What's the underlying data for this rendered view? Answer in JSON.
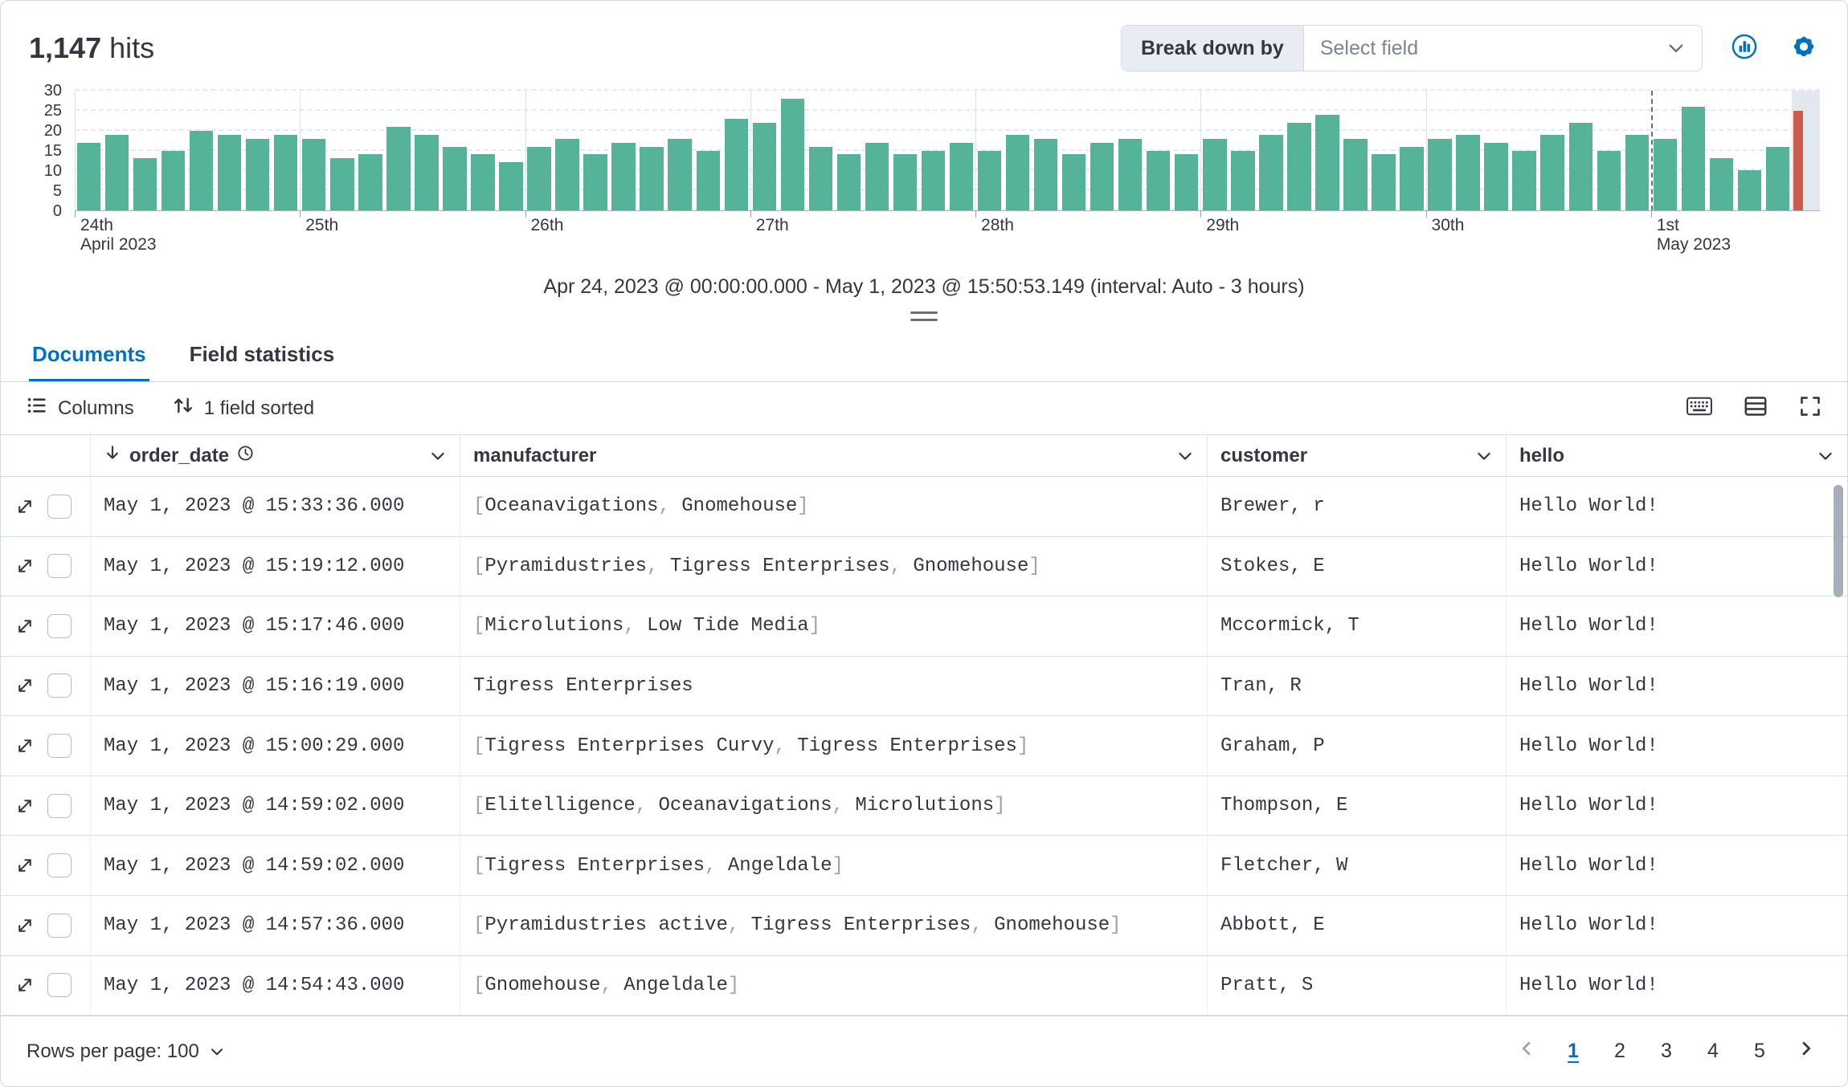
{
  "header": {
    "hits_count": "1,147",
    "hits_label": "hits",
    "breakdown_label": "Break down by",
    "breakdown_placeholder": "Select field"
  },
  "time_range": "Apr 24, 2023 @ 00:00:00.000 - May 1, 2023 @ 15:50:53.149 (interval: Auto - 3 hours)",
  "tabs": {
    "documents": "Documents",
    "field_statistics": "Field statistics"
  },
  "toolbar": {
    "columns": "Columns",
    "sorted": "1 field sorted"
  },
  "table": {
    "columns": {
      "order_date": "order_date",
      "manufacturer": "manufacturer",
      "customer": "customer",
      "hello": "hello"
    },
    "rows": [
      {
        "order_date": "May 1, 2023 @ 15:33:36.000",
        "manufacturer": [
          "Oceanavigations",
          "Gnomehouse"
        ],
        "customer": "Brewer, r",
        "hello": "Hello World!"
      },
      {
        "order_date": "May 1, 2023 @ 15:19:12.000",
        "manufacturer": [
          "Pyramidustries",
          "Tigress Enterprises",
          "Gnomehouse"
        ],
        "customer": "Stokes, E",
        "hello": "Hello World!"
      },
      {
        "order_date": "May 1, 2023 @ 15:17:46.000",
        "manufacturer": [
          "Microlutions",
          "Low Tide Media"
        ],
        "customer": "Mccormick, T",
        "hello": "Hello World!"
      },
      {
        "order_date": "May 1, 2023 @ 15:16:19.000",
        "manufacturer": "Tigress Enterprises",
        "customer": "Tran, R",
        "hello": "Hello World!"
      },
      {
        "order_date": "May 1, 2023 @ 15:00:29.000",
        "manufacturer": [
          "Tigress Enterprises Curvy",
          "Tigress Enterprises"
        ],
        "customer": "Graham, P",
        "hello": "Hello World!"
      },
      {
        "order_date": "May 1, 2023 @ 14:59:02.000",
        "manufacturer": [
          "Elitelligence",
          "Oceanavigations",
          "Microlutions"
        ],
        "customer": "Thompson, E",
        "hello": "Hello World!"
      },
      {
        "order_date": "May 1, 2023 @ 14:59:02.000",
        "manufacturer": [
          "Tigress Enterprises",
          "Angeldale"
        ],
        "customer": "Fletcher, W",
        "hello": "Hello World!"
      },
      {
        "order_date": "May 1, 2023 @ 14:57:36.000",
        "manufacturer": [
          "Pyramidustries active",
          "Tigress Enterprises",
          "Gnomehouse"
        ],
        "customer": "Abbott, E",
        "hello": "Hello World!"
      },
      {
        "order_date": "May 1, 2023 @ 14:54:43.000",
        "manufacturer": [
          "Gnomehouse",
          "Angeldale"
        ],
        "customer": "Pratt, S",
        "hello": "Hello World!"
      }
    ]
  },
  "footer": {
    "rows_per_page": "Rows per page: 100",
    "pages": [
      "1",
      "2",
      "3",
      "4",
      "5"
    ],
    "active_page": "1"
  },
  "chart_data": {
    "type": "bar",
    "title": "",
    "xlabel": "",
    "ylabel": "",
    "ylim": [
      0,
      30
    ],
    "yticks": [
      0,
      5,
      10,
      15,
      20,
      25,
      30
    ],
    "grid": true,
    "slots": 62,
    "bar_color": "#54B399",
    "values": [
      17,
      19,
      13,
      15,
      20,
      19,
      18,
      19,
      18,
      13,
      14,
      21,
      19,
      16,
      14,
      12,
      16,
      18,
      14,
      17,
      16,
      18,
      15,
      23,
      22,
      28,
      16,
      14,
      17,
      14,
      15,
      17,
      15,
      19,
      18,
      14,
      17,
      18,
      15,
      14,
      18,
      15,
      19,
      22,
      24,
      18,
      14,
      16,
      18,
      19,
      17,
      15,
      19,
      22,
      15,
      19,
      18,
      26,
      13,
      10,
      16
    ],
    "day_ticks": [
      {
        "index": 0,
        "label": "24th",
        "sub": "April 2023"
      },
      {
        "index": 8,
        "label": "25th"
      },
      {
        "index": 16,
        "label": "26th"
      },
      {
        "index": 24,
        "label": "27th"
      },
      {
        "index": 32,
        "label": "28th"
      },
      {
        "index": 40,
        "label": "29th"
      },
      {
        "index": 48,
        "label": "30th"
      },
      {
        "index": 56,
        "label": "1st",
        "sub": "May 2023",
        "dashed": true
      }
    ],
    "partial": {
      "start_index": 61,
      "marker_value": 25,
      "marker_color": "#CC5B4B",
      "band_color": "#E3E7EE"
    }
  },
  "colors": {
    "accent": "#0071C2",
    "bar": "#54B399",
    "partial_marker": "#CC5B4B"
  }
}
